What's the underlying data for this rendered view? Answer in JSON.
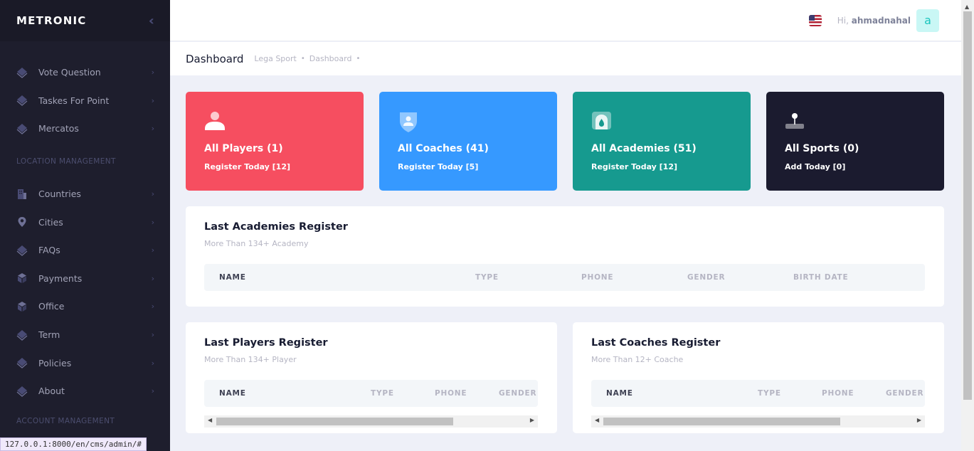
{
  "sidebar": {
    "brand": "METRONIC",
    "toggle_icon": "double-chevron-left-icon",
    "items_top": [
      {
        "label": "Vote Question",
        "icon": "diamond-icon"
      },
      {
        "label": "Taskes For Point",
        "icon": "diamond-icon"
      },
      {
        "label": "Mercatos",
        "icon": "diamond-icon"
      }
    ],
    "section_location": "LOCATION MANAGEMENT",
    "items_location": [
      {
        "label": "Countries",
        "icon": "building-icon"
      },
      {
        "label": "Cities",
        "icon": "map-pin-icon"
      },
      {
        "label": "FAQs",
        "icon": "diamond-icon"
      },
      {
        "label": "Payments",
        "icon": "cube-icon"
      },
      {
        "label": "Office",
        "icon": "cube-icon"
      },
      {
        "label": "Term",
        "icon": "diamond-icon"
      },
      {
        "label": "Policies",
        "icon": "diamond-icon"
      },
      {
        "label": "About",
        "icon": "diamond-icon"
      }
    ],
    "section_account": "ACCOUNT MANAGEMENT"
  },
  "status_bar": {
    "url": "127.0.0.1:8000/en/cms/admin/#"
  },
  "header": {
    "greeting": "Hi,",
    "username": "ahmadnahal",
    "avatar_letter": "a",
    "flag_icon": "us-flag-icon"
  },
  "subheader": {
    "title": "Dashboard",
    "breadcrumbs": [
      "Lega Sport",
      "Dashboard"
    ]
  },
  "stats": [
    {
      "title": "All Players (1)",
      "subtitle": "Register Today [12]",
      "icon": "user-icon",
      "color": "#f64e60"
    },
    {
      "title": "All Coaches (41)",
      "subtitle": "Register Today [5]",
      "icon": "shield-user-icon",
      "color": "#3699ff"
    },
    {
      "title": "All Academies (51)",
      "subtitle": "Register Today [12]",
      "icon": "fire-icon",
      "color": "#169a8f"
    },
    {
      "title": "All Sports (0)",
      "subtitle": "Add Today [0]",
      "icon": "joystick-icon",
      "color": "#1b1b2f"
    }
  ],
  "academies": {
    "title": "Last Academies Register",
    "subtitle": "More Than 134+ Academy",
    "columns": [
      "NAME",
      "TYPE",
      "PHONE",
      "GENDER",
      "BIRTH DATE"
    ]
  },
  "players": {
    "title": "Last Players Register",
    "subtitle": "More Than 134+ Player",
    "columns": [
      "NAME",
      "TYPE",
      "PHONE",
      "GENDER"
    ]
  },
  "coaches": {
    "title": "Last Coaches Register",
    "subtitle": "More Than 12+ Coache",
    "columns": [
      "NAME",
      "TYPE",
      "PHONE",
      "GENDER"
    ]
  }
}
